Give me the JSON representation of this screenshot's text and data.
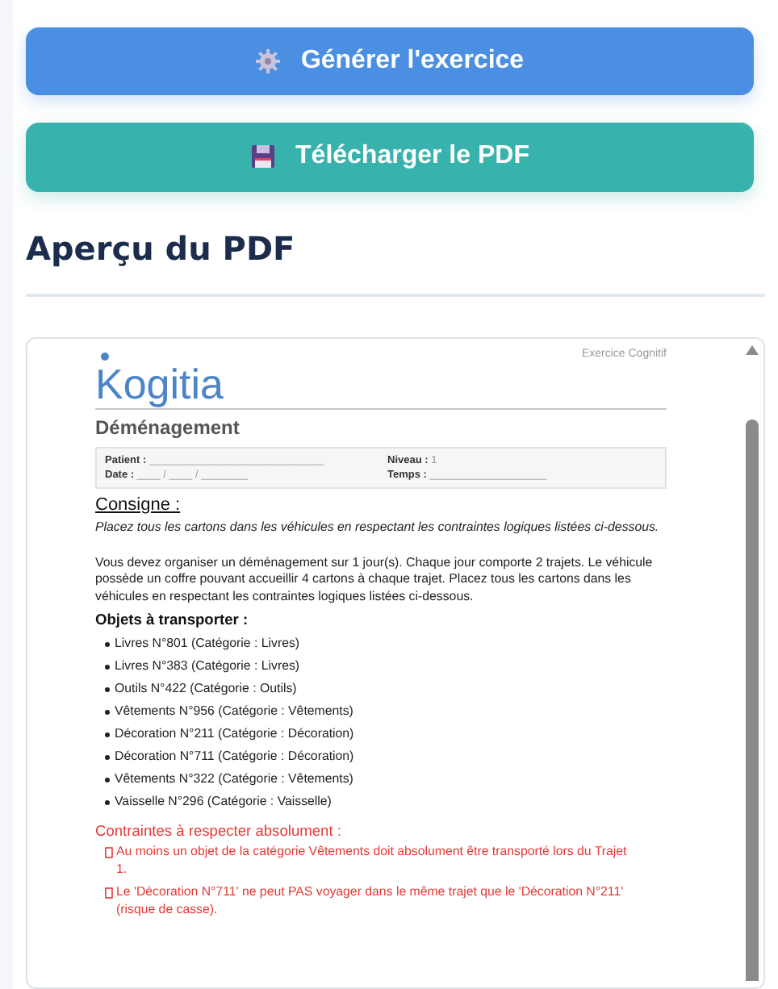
{
  "actions": [
    {
      "kind": "generate",
      "label": "Générer l'exercice"
    },
    {
      "kind": "download",
      "label": "Télécharger le PDF"
    }
  ],
  "preview": {
    "title": "Aperçu du PDF",
    "document": {
      "logo": "Kogitia",
      "tag": "Exercice Cognitif",
      "exercise_title": "Déménagement",
      "fields": [
        {
          "label": "Patient :",
          "blank": "______________________________"
        },
        {
          "label": "Niveau :",
          "blank": "1"
        },
        {
          "label": "Date :",
          "blank": "____ / ____ / ________"
        },
        {
          "label": "Temps :",
          "blank": "____________________"
        }
      ],
      "instruction_heading": "Consigne :",
      "instruction": "Placez tous les cartons dans les véhicules en respectant les contraintes logiques listées ci-dessous.",
      "description": "Vous devez organiser un déménagement sur 1 jour(s). Chaque jour comporte 2 trajets. Le véhicule possède un coffre pouvant accueillir 4 cartons à chaque trajet. Placez tous les cartons dans les véhicules en respectant les contraintes logiques listées ci-dessous.",
      "objects_heading": "Objets à transporter :",
      "objects": [
        "Livres N°801 (Catégorie : Livres)",
        "Livres N°383 (Catégorie : Livres)",
        "Outils N°422 (Catégorie : Outils)",
        "Vêtements N°956 (Catégorie : Vêtements)",
        "Décoration N°211 (Catégorie : Décoration)",
        "Décoration N°711 (Catégorie : Décoration)",
        "Vêtements N°322 (Catégorie : Vêtements)",
        "Vaisselle N°296 (Catégorie : Vaisselle)"
      ],
      "constraints_heading": "Contraintes à respecter absolument :",
      "constraints": [
        "Au moins un objet de la catégorie Vêtements doit absolument être transporté lors du Trajet 1.",
        "Le 'Décoration N°711' ne peut PAS voyager dans le même trajet que le 'Décoration N°211' (risque de casse)."
      ]
    }
  }
}
